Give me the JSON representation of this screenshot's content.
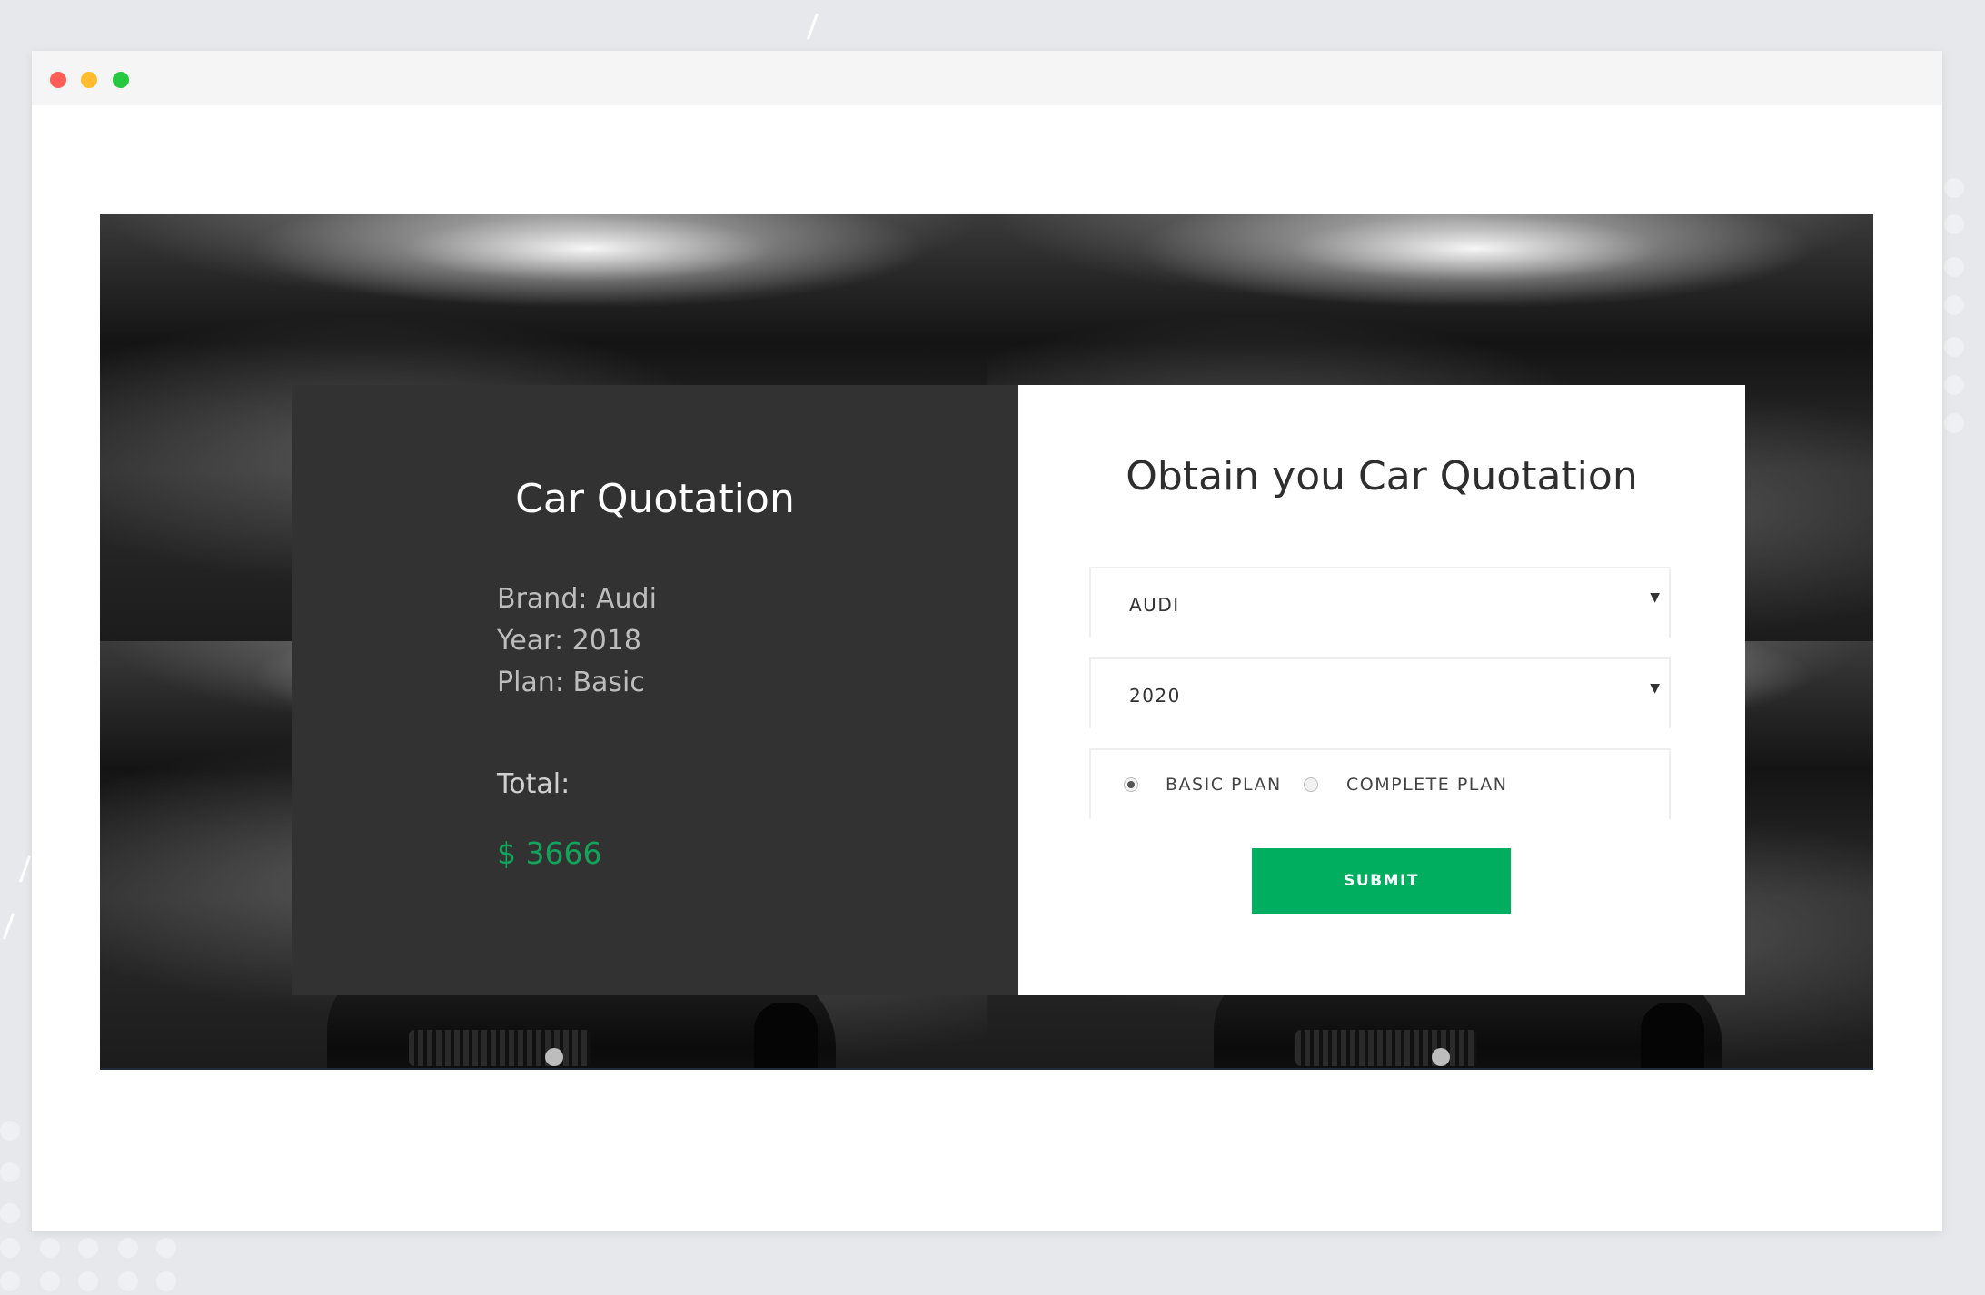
{
  "window": {
    "controls": [
      "close",
      "minimize",
      "maximize"
    ],
    "control_colors": [
      "#ff5f57",
      "#febc2e",
      "#28c840"
    ]
  },
  "summary": {
    "title": "Car Quotation",
    "brand_line": "Brand: Audi",
    "year_line": "Year: 2018",
    "plan_line": "Plan: Basic",
    "total_label": "Total:",
    "total_amount": "$ 3666",
    "accent_color": "#12a45a"
  },
  "form": {
    "title": "Obtain you Car Quotation",
    "brand_select": {
      "value": "AUDI"
    },
    "year_select": {
      "value": "2020"
    },
    "plan_options": [
      {
        "label": "BASIC PLAN",
        "checked": true
      },
      {
        "label": "COMPLETE PLAN",
        "checked": false
      }
    ],
    "submit_label": "SUBMIT",
    "submit_color": "#00ae60"
  }
}
